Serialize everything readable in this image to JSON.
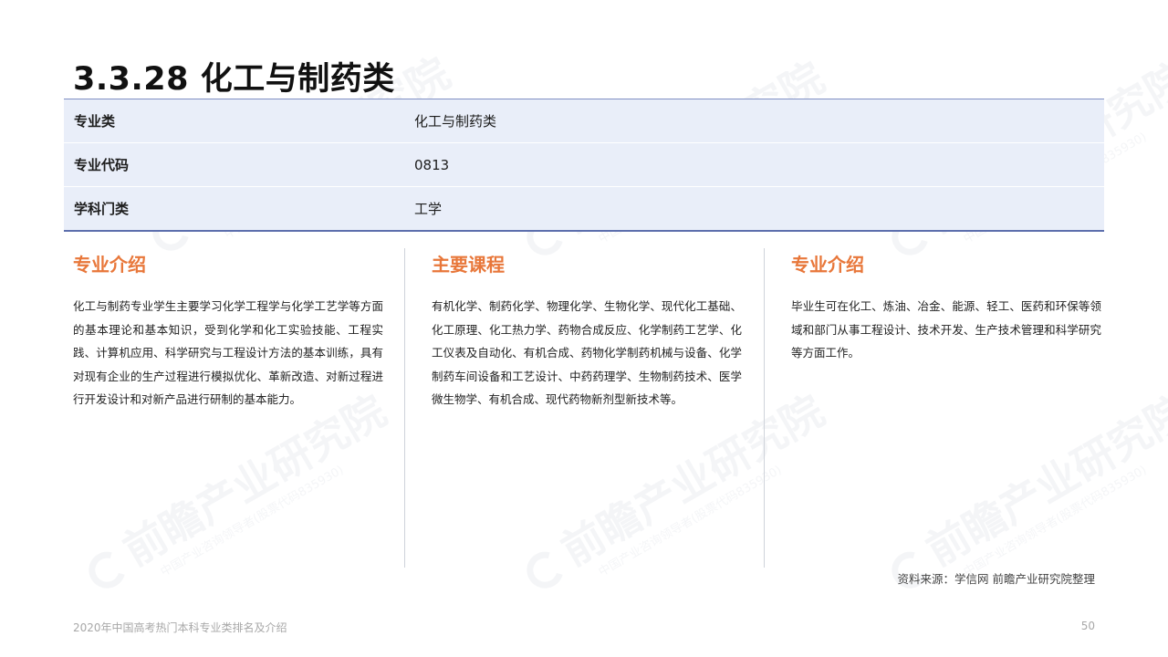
{
  "page": {
    "title": "3.3.28 化工与制药类",
    "watermark_text": "前瞻产业研究院",
    "watermark_sub": "中国产业咨询领导者(股票代码835930)"
  },
  "info_table": [
    {
      "key": "专业类",
      "value": "化工与制药类"
    },
    {
      "key": "专业代码",
      "value": "0813"
    },
    {
      "key": "学科门类",
      "value": "工学"
    }
  ],
  "sections": [
    {
      "heading": "专业介绍",
      "body": "化工与制药专业学生主要学习化学工程学与化学工艺学等方面的基本理论和基本知识，受到化学和化工实验技能、工程实践、计算机应用、科学研究与工程设计方法的基本训练，具有对现有企业的生产过程进行模拟优化、革新改造、对新过程进行开发设计和对新产品进行研制的基本能力。"
    },
    {
      "heading": "主要课程",
      "body": "有机化学、制药化学、物理化学、生物化学、现代化工基础、化工原理、化工热力学、药物合成反应、化学制药工艺学、化工仪表及自动化、有机合成、药物化学制药机械与设备、化学制药车间设备和工艺设计、中药药理学、生物制药技术、医学微生物学、有机合成、现代药物新剂型新技术等。"
    },
    {
      "heading": "专业介绍",
      "body": "毕业生可在化工、炼油、冶金、能源、轻工、医药和环保等领域和部门从事工程设计、技术开发、生产技术管理和科学研究等方面工作。"
    }
  ],
  "source_note": "资料来源：学信网 前瞻产业研究院整理",
  "footer": {
    "left": "2020年中国高考热门本科专业类排名及介绍",
    "page_number": "50"
  },
  "colors": {
    "accent": "#e8773a",
    "table_bg": "#e9eef9",
    "table_border": "#5d6fad"
  }
}
